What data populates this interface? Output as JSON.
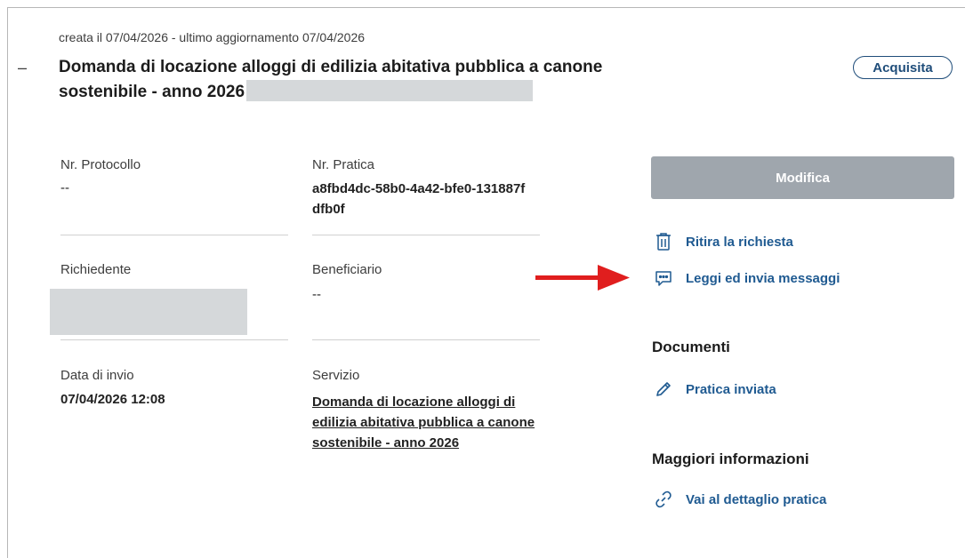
{
  "header": {
    "meta": "creata il 07/04/2026 - ultimo aggiornamento 07/04/2026",
    "title": "Domanda di locazione alloggi di edilizia abitativa pubblica a canone sostenibile - anno 2026",
    "collapse_symbol": "–",
    "status": "Acquisita"
  },
  "details": {
    "protocollo": {
      "label": "Nr. Protocollo",
      "value": "--"
    },
    "pratica": {
      "label": "Nr. Pratica",
      "value": "a8fbd4dc-58b0-4a42-bfe0-131887fdfb0f"
    },
    "richiedente": {
      "label": "Richiedente",
      "value": ""
    },
    "beneficiario": {
      "label": "Beneficiario",
      "value": "--"
    },
    "data_invio": {
      "label": "Data di invio",
      "value": "07/04/2026 12:08"
    },
    "servizio": {
      "label": "Servizio",
      "value": "Domanda di locazione alloggi di edilizia abitativa pubblica a canone sostenibile - anno 2026"
    }
  },
  "actions": {
    "modify": "Modifica",
    "withdraw": "Ritira la richiesta",
    "messages": "Leggi ed invia messaggi"
  },
  "documents": {
    "title": "Documenti",
    "items": [
      "Pratica inviata"
    ]
  },
  "more_info": {
    "title": "Maggiori informazioni",
    "link": "Vai al dettaglio pratica"
  },
  "icons": [
    "trash-icon",
    "message-icon",
    "pencil-icon",
    "link-icon",
    "red-arrow-annotation"
  ],
  "colors": {
    "link": "#1f5a91",
    "badge": "#1f4d7a",
    "button_disabled": "#9fa6ad",
    "arrow": "#e01e1e",
    "redaction": "#d5d8da"
  }
}
